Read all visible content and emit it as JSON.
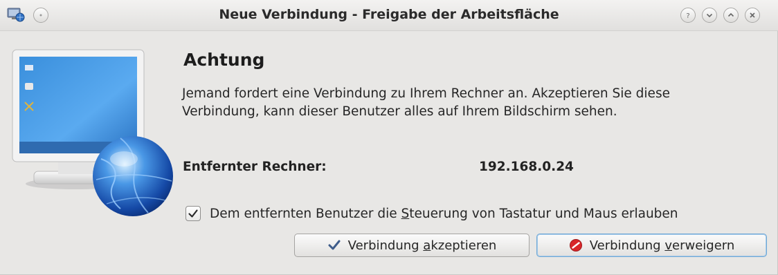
{
  "window": {
    "title": "Neue Verbindung - Freigabe der Arbeitsfläche",
    "buttons": [
      "help",
      "minimize",
      "maximize",
      "close"
    ]
  },
  "dialog": {
    "heading": "Achtung",
    "message_line1": "Jemand fordert eine Verbindung zu Ihrem Rechner an. Akzeptieren Sie diese",
    "message_line2": "Verbindung, kann dieser Benutzer alles auf Ihrem Bildschirm sehen.",
    "remote_label": "Entfernter Rechner:",
    "remote_value": "192.168.0.24",
    "checkbox": {
      "checked": true,
      "label_before": "Dem entfernten Benutzer die ",
      "label_mnemonic": "S",
      "label_after": "teuerung von Tastatur und Maus erlauben"
    },
    "accept_button": {
      "before": "Verbindung ",
      "mnemonic": "a",
      "after": "kzeptieren",
      "icon": "checkmark-icon"
    },
    "reject_button": {
      "before": "Verbindung ",
      "mnemonic": "v",
      "after": "erweigern",
      "icon": "reject-icon"
    }
  },
  "colors": {
    "window_bg": "#e8e7e5",
    "focus_border": "#6fa8d6",
    "reject_icon": "#d9262a",
    "check_icon": "#3e5c8a"
  }
}
